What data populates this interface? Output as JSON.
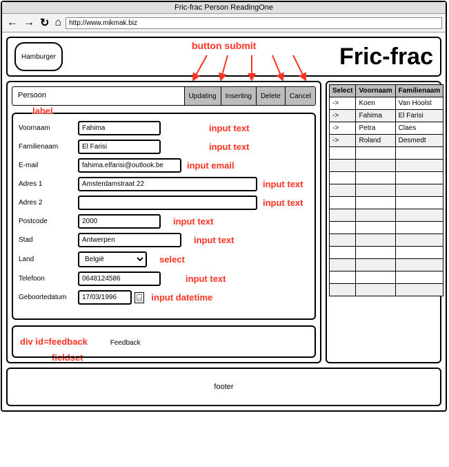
{
  "window": {
    "title": "Fric-frac Person ReadingOne",
    "url": "http://www.mikmak.biz"
  },
  "header": {
    "hamburger": "Hamburger",
    "brand": "Fric-frac"
  },
  "panel": {
    "title": "Persoon",
    "buttons": {
      "updating": "Updating",
      "inserting": "Inserting",
      "delete": "Delete",
      "cancel": "Cancel"
    }
  },
  "labels": {
    "voornaam": "Voornaam",
    "familienaam": "Familienaam",
    "email": "E-mail",
    "adres1": "Adres 1",
    "adres2": "Adres 2",
    "postcode": "Postcode",
    "stad": "Stad",
    "land": "Land",
    "telefoon": "Telefoon",
    "geboortedatum": "Geboortedatum"
  },
  "values": {
    "voornaam": "Fahima",
    "familienaam": "El Farisi",
    "email": "fahima.elfarisi@outlook.be",
    "adres1": "Amsterdamstraat 22",
    "adres2": "",
    "postcode": "2000",
    "stad": "Antwerpen",
    "land": "België",
    "telefoon": "0648124586",
    "geboortedatum": "17/03/1996"
  },
  "feedback": {
    "text": "Feedback"
  },
  "table": {
    "headers": {
      "select": "Select",
      "voornaam": "Voornaam",
      "familienaam": "Familienaam"
    },
    "rows": [
      {
        "select": "->",
        "voornaam": "Koen",
        "familienaam": "Van Hoolst"
      },
      {
        "select": "->",
        "voornaam": "Fahima",
        "familienaam": "El Farisi"
      },
      {
        "select": "->",
        "voornaam": "Petra",
        "familienaam": "Claes"
      },
      {
        "select": "->",
        "voornaam": "Roland",
        "familienaam": "Desmedt"
      }
    ]
  },
  "footer": {
    "text": "footer"
  },
  "annotations": {
    "button_submit": "button submit",
    "label": "label",
    "input_text": "input text",
    "input_email": "input email",
    "select": "select",
    "input_datetime": "input datetime",
    "fieldset": "fieldset",
    "div_feedback": "div id=feedback"
  }
}
